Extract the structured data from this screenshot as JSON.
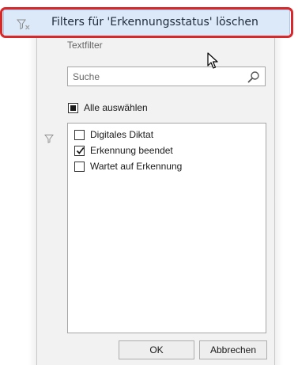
{
  "menu": {
    "clear_filter_label": "Filters für 'Erkennungsstatus' löschen",
    "icon": "clear-filter-icon"
  },
  "panel": {
    "textfilter_label": "Textfilter",
    "search": {
      "placeholder": "Suche",
      "value": ""
    },
    "select_all": {
      "label": "Alle auswählen",
      "state": "indeterminate"
    },
    "items": [
      {
        "label": "Digitales Diktat",
        "checked": false
      },
      {
        "label": "Erkennung beendet",
        "checked": true
      },
      {
        "label": "Wartet auf Erkennung",
        "checked": false
      }
    ],
    "buttons": {
      "ok": "OK",
      "cancel": "Abbrechen"
    }
  },
  "colors": {
    "highlight_outline": "#d9282a",
    "menu_hover_bg": "#dce9f9",
    "panel_bg": "#f2f2f2"
  }
}
